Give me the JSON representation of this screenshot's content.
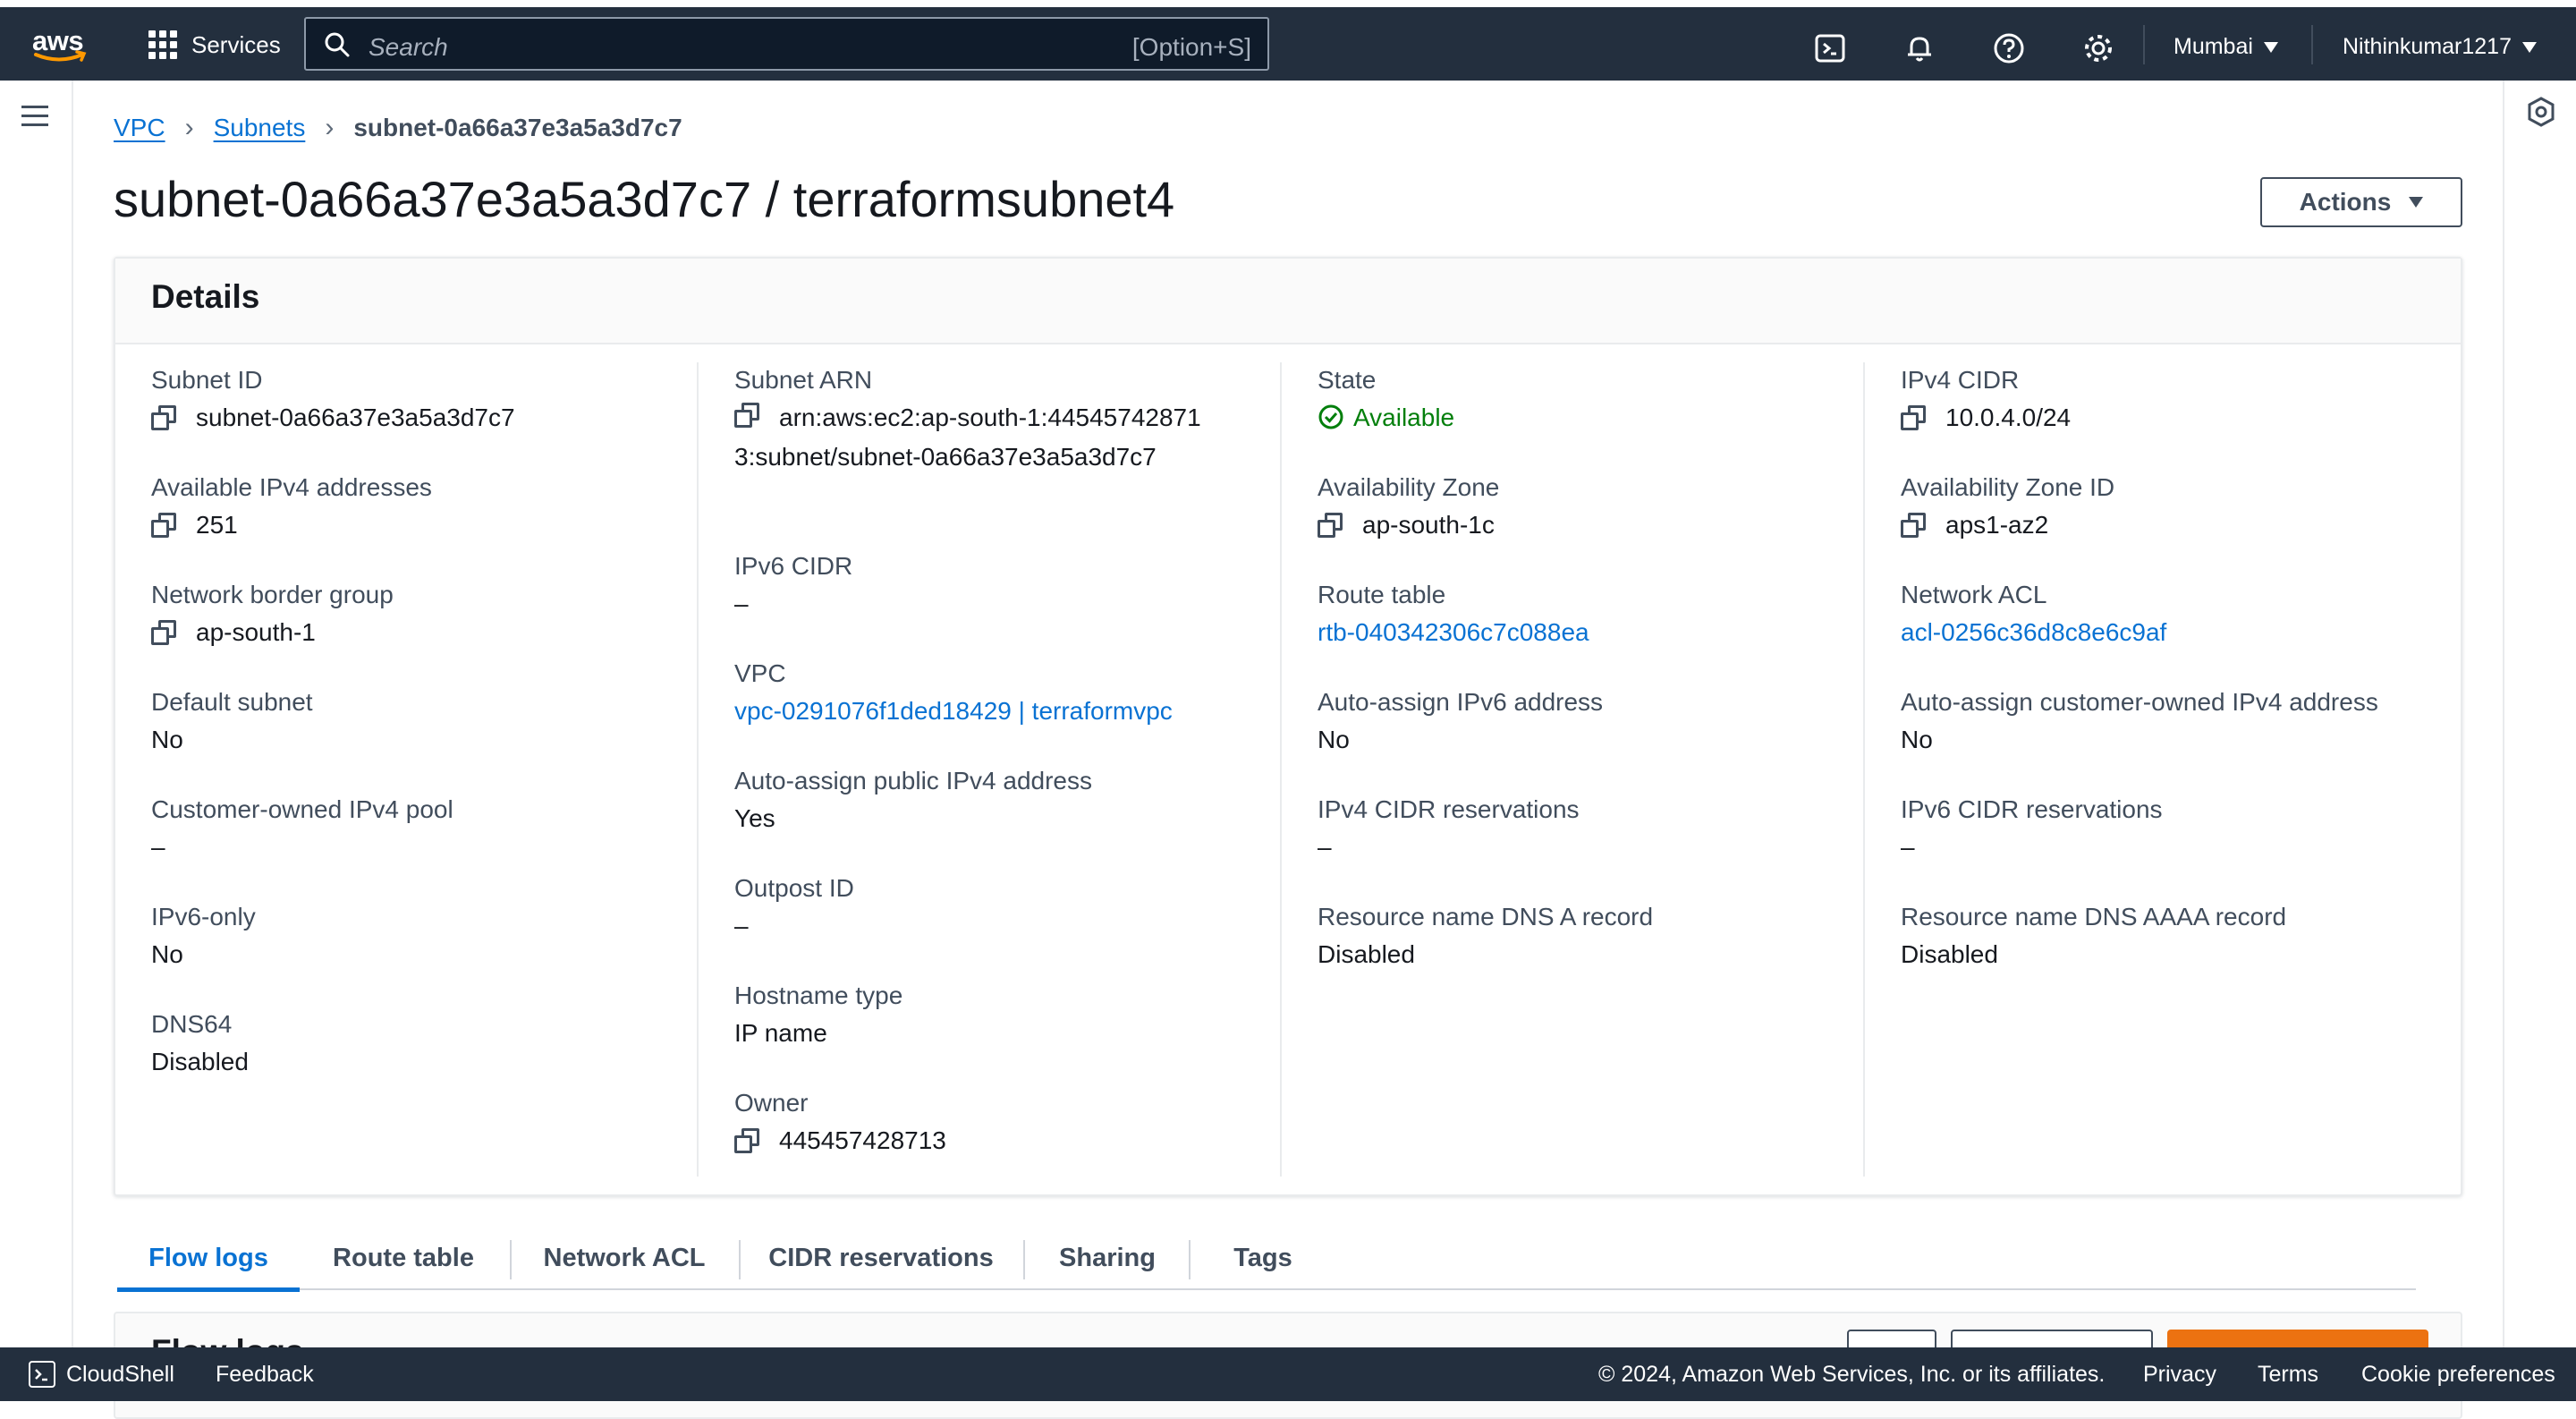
{
  "topbar": {
    "logo": "aws",
    "services_label": "Services",
    "search_placeholder": "Search",
    "search_shortcut": "[Option+S]",
    "region": "Mumbai",
    "user": "Nithinkumar1217"
  },
  "breadcrumb": {
    "items": [
      "VPC",
      "Subnets"
    ],
    "current": "subnet-0a66a37e3a5a3d7c7"
  },
  "page": {
    "title": "subnet-0a66a37e3a5a3d7c7 / terraformsubnet4",
    "actions_label": "Actions"
  },
  "details": {
    "heading": "Details",
    "col1": [
      {
        "label": "Subnet ID",
        "value": "subnet-0a66a37e3a5a3d7c7"
      },
      {
        "label": "Available IPv4 addresses",
        "value": "251"
      },
      {
        "label": "Network border group",
        "value": "ap-south-1"
      },
      {
        "label": "Default subnet",
        "value": "No"
      },
      {
        "label": "Customer-owned IPv4 pool",
        "value": "–"
      },
      {
        "label": "IPv6-only",
        "value": "No"
      },
      {
        "label": "DNS64",
        "value": "Disabled"
      }
    ],
    "col2": [
      {
        "label": "Subnet ARN",
        "value": "arn:aws:ec2:ap-south-1:445457428713:subnet/subnet-0a66a37e3a5a3d7c7"
      },
      {
        "label": "IPv6 CIDR",
        "value": "–"
      },
      {
        "label": "VPC",
        "value": "vpc-0291076f1ded18429 | terraformvpc"
      },
      {
        "label": "Auto-assign public IPv4 address",
        "value": "Yes"
      },
      {
        "label": "Outpost ID",
        "value": "–"
      },
      {
        "label": "Hostname type",
        "value": "IP name"
      },
      {
        "label": "Owner",
        "value": "445457428713"
      }
    ],
    "col3": [
      {
        "label": "State",
        "value": "Available"
      },
      {
        "label": "Availability Zone",
        "value": "ap-south-1c"
      },
      {
        "label": "Route table",
        "value": "rtb-040342306c7c088ea"
      },
      {
        "label": "Auto-assign IPv6 address",
        "value": "No"
      },
      {
        "label": "IPv4 CIDR reservations",
        "value": "–"
      },
      {
        "label": "Resource name DNS A record",
        "value": "Disabled"
      }
    ],
    "col4": [
      {
        "label": "IPv4 CIDR",
        "value": "10.0.4.0/24"
      },
      {
        "label": "Availability Zone ID",
        "value": "aps1-az2"
      },
      {
        "label": "Network ACL",
        "value": "acl-0256c36d8c8e6c9af"
      },
      {
        "label": "Auto-assign customer-owned IPv4 address",
        "value": "No"
      },
      {
        "label": "IPv6 CIDR reservations",
        "value": "–"
      },
      {
        "label": "Resource name DNS AAAA record",
        "value": "Disabled"
      }
    ]
  },
  "tabs": [
    "Flow logs",
    "Route table",
    "Network ACL",
    "CIDR reservations",
    "Sharing",
    "Tags"
  ],
  "flow_panel": {
    "title": "Flow logs"
  },
  "footer": {
    "cloudshell": "CloudShell",
    "feedback": "Feedback",
    "copyright": "© 2024, Amazon Web Services, Inc. or its affiliates.",
    "privacy": "Privacy",
    "terms": "Terms",
    "cookies": "Cookie preferences"
  },
  "colors": {
    "nav_bg": "#232f3e",
    "link": "#0972d3",
    "success": "#037f0c",
    "primary_button": "#ec7211"
  }
}
